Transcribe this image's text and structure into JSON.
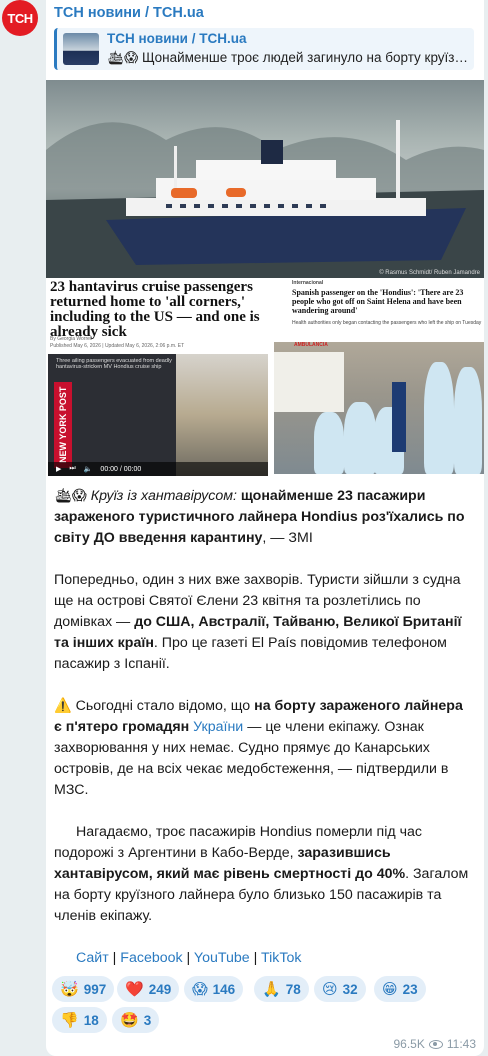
{
  "channel": {
    "avatar_text": "ТСН",
    "name": "ТСН новини / TCH.ua"
  },
  "reply": {
    "title": "ТСН новини / TCH.ua",
    "text": "🛳😱 Щонайменше троє людей загинуло на борту круїзного лайнера Hondius"
  },
  "photo": {
    "credit": "© Rasmus Schmidt/ Ruben Jamandre",
    "left_article": {
      "headline": "23 hantavirus cruise passengers returned home to 'all corners,' including to the US — and one is already sick",
      "byline": "By Georgia Worrell",
      "dates": "Published May 6, 2026 | Updated May 6, 2026, 2:06 p.m. ET",
      "video_caption": "Three ailing passengers evacuated from deadly hantavirus-stricken MV Hondius cruise ship",
      "brand": "NEW YORK POST",
      "time": "00:00 / 00:00"
    },
    "right_article": {
      "tag": "Internacional",
      "headline": "Spanish passenger on the 'Hondius': 'There are 23 people who got off on Saint Helena and have been wandering around'",
      "sub": "Health authorities only began contacting the passengers who left the ship on Tuesday",
      "sign": "AMBULANCIA"
    }
  },
  "post": {
    "p1_emoji": "🛳😱",
    "p1_italic": "Круїз із хантавірусом:",
    "p1_bold": "щонайменше 23 пасажири зараженого туристичного лайнера Hondius роз'їхались по світу ДО введення карантину",
    "p1_tail": ", — ЗМІ",
    "p2_a": "Попередньо, один з них вже захворів. Туристи зійшли з судна ще на острові Святої Єлени 23 квітня та розлетілись по домівках — ",
    "p2_bold": "до США, Австралії, Тайваню, Великої Британії та інших країн",
    "p2_b": ". Про це газеті El País повідомив телефоном пасажир з Іспанії.",
    "p3_emoji": "⚠️",
    "p3_a": " Сьогодні стало відомо, що ",
    "p3_bold": "на борту зараженого лайнера є п'ятеро громадян ",
    "p3_link": "України",
    "p3_b": " — це члени екіпажу. Ознак захворювання у них немає. Судно прямує до Канарських островів, де на всіх чекає медобстеження, — підтвердили в МЗС.",
    "p4_a": "Нагадаємо, троє пасажирів Hondius померли під час подорожі з Аргентини в Кабо-Верде, ",
    "p4_bold": "заразившись хантавірусом, який має рівень смертності до 40%",
    "p4_b": ". Загалом на борту круїзного лайнера було близько 150 пасажирів та членів екіпажу.",
    "links": [
      "Сайт",
      "Facebook",
      "YouTube",
      "TikTok"
    ]
  },
  "reactions": [
    {
      "emoji": "🤯",
      "count": "997"
    },
    {
      "emoji": "❤️",
      "count": "249"
    },
    {
      "emoji": "😱",
      "count": "146"
    },
    {
      "emoji": "🙏",
      "count": "78"
    },
    {
      "emoji": "😢",
      "count": "32"
    },
    {
      "emoji": "😁",
      "count": "23"
    },
    {
      "emoji": "👎",
      "count": "18"
    },
    {
      "emoji": "🤩",
      "count": "3"
    }
  ],
  "meta": {
    "views": "96.5K",
    "time": "11:43"
  },
  "colors": {
    "accent": "#2a7ac0",
    "brand_red": "#e31b23",
    "reaction_bg": "#e3eef8"
  }
}
